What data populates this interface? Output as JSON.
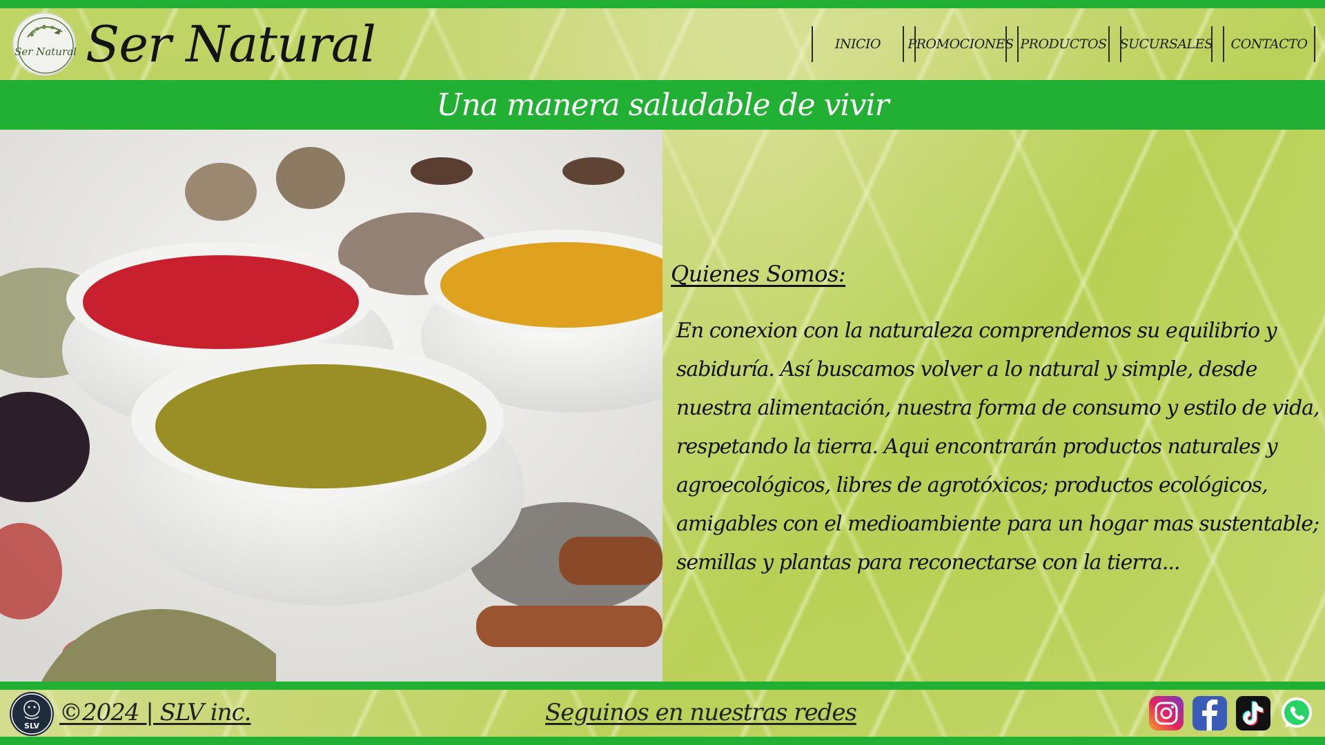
{
  "header": {
    "brand": "Ser Natural",
    "logo_text": "Ser Natural",
    "nav": [
      {
        "label": "INICIO"
      },
      {
        "label": "PROMOCIONES"
      },
      {
        "label": "PRODUCTOS"
      },
      {
        "label": "SUCURSALES"
      },
      {
        "label": "CONTACTO"
      }
    ]
  },
  "banner": {
    "tagline": "Una manera saludable de vivir"
  },
  "about": {
    "title": "Quienes Somos:",
    "text": "En conexion con la naturaleza comprendemos su equilibrio y sabiduría. Así buscamos volver a lo natural y simple, desde nuestra alimentación, nuestra forma de consumo y estilo de vida, respetando la tierra. Aqui encontrarán productos naturales y agroecológicos, libres de agrotóxicos; productos ecológicos, amigables con el medioambiente para un hogar mas sustentable; semillas y plantas para reconectarse con la tierra..."
  },
  "footer": {
    "copyright": "©2024 | SLV inc.",
    "slv_logo_text": "SLV",
    "follow": "Seguinos en nuestras redes",
    "social": [
      {
        "name": "instagram-icon"
      },
      {
        "name": "facebook-icon"
      },
      {
        "name": "tiktok-icon"
      },
      {
        "name": "whatsapp-icon"
      }
    ]
  },
  "colors": {
    "accent_green": "#22b034",
    "leaf_background": "#c9d873",
    "text": "#111111"
  }
}
